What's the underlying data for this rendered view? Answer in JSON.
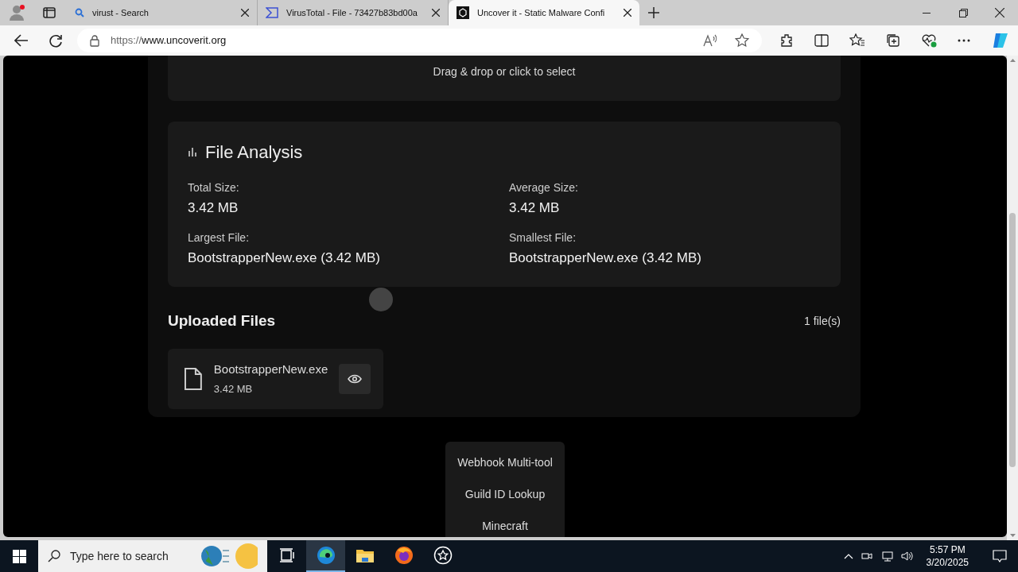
{
  "browser": {
    "tabs": [
      {
        "kind": "search",
        "title": "virust - Search",
        "selected": false
      },
      {
        "kind": "virustotal",
        "title": "VirusTotal - File - 73427b83bd00a",
        "selected": false
      },
      {
        "kind": "site",
        "title": "Uncover it - Static Malware Confi",
        "selected": true
      }
    ],
    "url_scheme": "https://",
    "url_host": "www.uncoverit.org"
  },
  "upload": {
    "hint": "Drag & drop or click to select"
  },
  "analysis": {
    "title": "File Analysis",
    "stats": [
      {
        "label": "Total Size:",
        "value": "3.42 MB"
      },
      {
        "label": "Average Size:",
        "value": "3.42 MB"
      },
      {
        "label": "Largest File:",
        "value": "BootstrapperNew.exe (3.42 MB)"
      },
      {
        "label": "Smallest File:",
        "value": "BootstrapperNew.exe (3.42 MB)"
      }
    ]
  },
  "uploaded": {
    "title": "Uploaded Files",
    "count": "1 file(s)",
    "files": [
      {
        "name": "BootstrapperNew.exe",
        "size": "3.42 MB"
      }
    ]
  },
  "menu": [
    "Webhook Multi-tool",
    "Guild ID Lookup",
    "Minecraft"
  ],
  "taskbar": {
    "search_placeholder": "Type here to search",
    "apps": [
      {
        "kind": "taskview",
        "active": false
      },
      {
        "kind": "edge",
        "active": true
      },
      {
        "kind": "explorer",
        "active": false
      },
      {
        "kind": "firefox",
        "active": false
      },
      {
        "kind": "star",
        "active": false
      }
    ],
    "time": "5:57 PM",
    "date": "3/20/2025"
  }
}
